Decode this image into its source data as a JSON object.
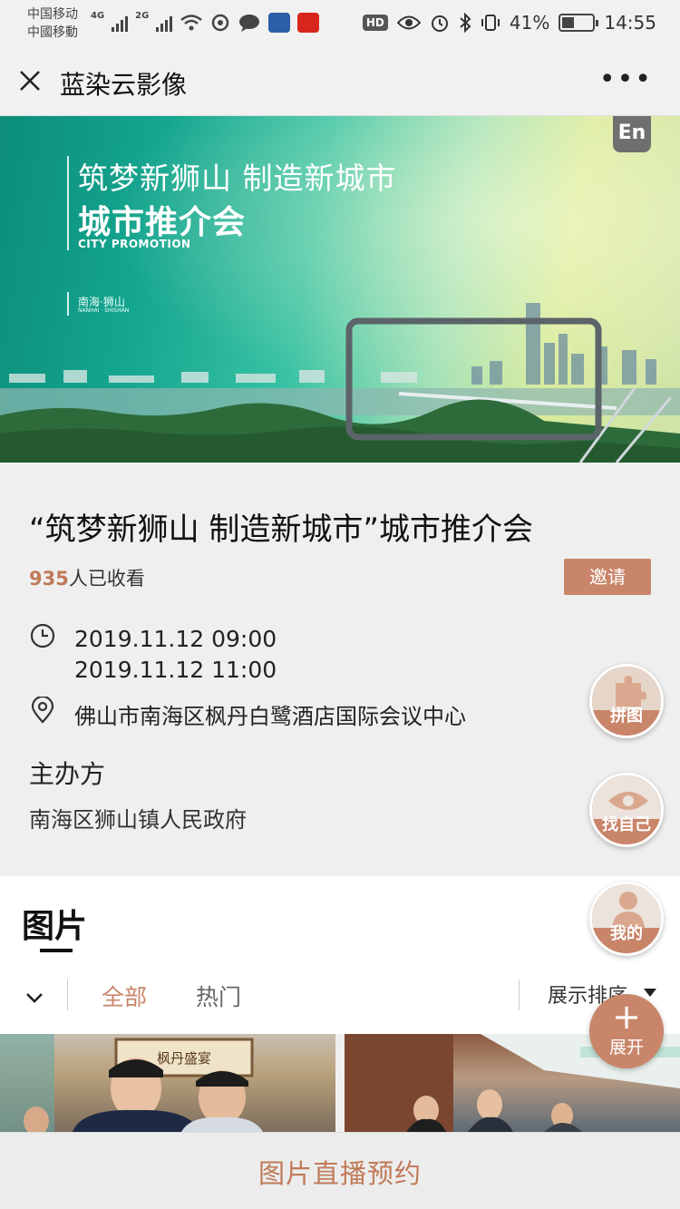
{
  "status_bar": {
    "carrier_1": "中国移动",
    "carrier_2": "中國移動",
    "net_1": "4G",
    "net_2": "2G",
    "hd": "HD",
    "battery": "41%",
    "battery_level": 0.41,
    "time": "14:55",
    "icons_left": [
      "signal-icon",
      "signal-icon",
      "wifi-icon",
      "sync-icon",
      "chat-icon",
      "app-icon",
      "app-icon"
    ],
    "icons_right": [
      "hd-icon",
      "eye-icon",
      "alarm-icon",
      "bluetooth-icon",
      "vibrate-icon",
      "battery-icon"
    ]
  },
  "header": {
    "title": "蓝染云影像",
    "close_icon": "close-icon",
    "more_icon": "more-icon"
  },
  "banner": {
    "subtitle": "筑梦新狮山 制造新城市",
    "main_title": "城市推介会",
    "english": "CITY PROMOTION",
    "location": "南海·狮山",
    "location_en": "NANHAI · SHISHAN",
    "lang_button": "En"
  },
  "event": {
    "title": "“筑梦新狮山 制造新城市”城市推介会",
    "view_count": "935",
    "view_suffix": "人已收看",
    "invite_label": "邀请",
    "start_time": "2019.11.12 09:00",
    "end_time": "2019.11.12 11:00",
    "address": "佛山市南海区枫丹白鹭酒店国际会议中心",
    "host_heading": "主办方",
    "host_name": "南海区狮山镇人民政府"
  },
  "photos": {
    "heading": "图片",
    "tabs": [
      "全部",
      "热门"
    ],
    "active_tab": "全部",
    "sort_label": "展示排序",
    "photo1_sign": "枫丹盛宴"
  },
  "fabs": {
    "puzzle": "拼图",
    "find_self": "找自己",
    "mine": "我的",
    "expand": "展开"
  },
  "bottom": {
    "reserve_label": "图片直播预约"
  },
  "colors": {
    "accent": "#c9856a",
    "count": "#c07a58"
  }
}
